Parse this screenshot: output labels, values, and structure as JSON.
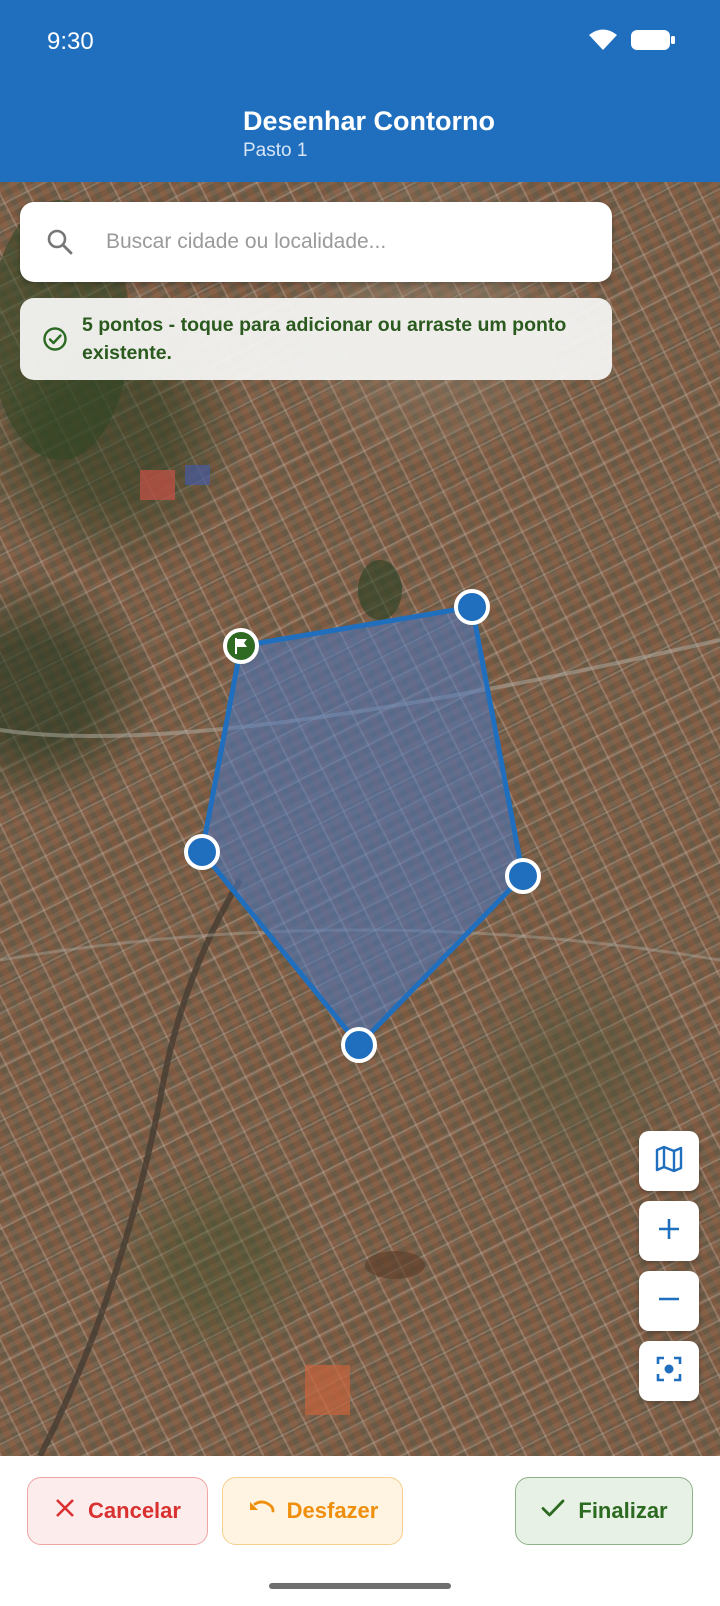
{
  "status_bar": {
    "time": "9:30"
  },
  "header": {
    "title": "Desenhar Contorno",
    "subtitle": "Pasto 1"
  },
  "search": {
    "placeholder": "Buscar cidade ou localidade..."
  },
  "info": {
    "message": "5 pontos - toque para adicionar ou arraste um ponto existente."
  },
  "map": {
    "style": "satellite",
    "polygon": {
      "point_count": 5,
      "fill_color": "#4a78c2",
      "stroke_color": "#1f6fbe"
    },
    "start_marker_color": "#2e6a22",
    "controls": [
      {
        "name": "map-layers",
        "icon": "map-icon"
      },
      {
        "name": "zoom-in",
        "icon": "plus-icon"
      },
      {
        "name": "zoom-out",
        "icon": "minus-icon"
      },
      {
        "name": "center",
        "icon": "focus-icon"
      }
    ]
  },
  "actions": {
    "cancel": "Cancelar",
    "undo": "Desfazer",
    "finish": "Finalizar"
  },
  "colors": {
    "primary": "#1f6fbe",
    "cancel": "#d93030",
    "undo": "#ef8f0d",
    "finish": "#2c6a22"
  }
}
